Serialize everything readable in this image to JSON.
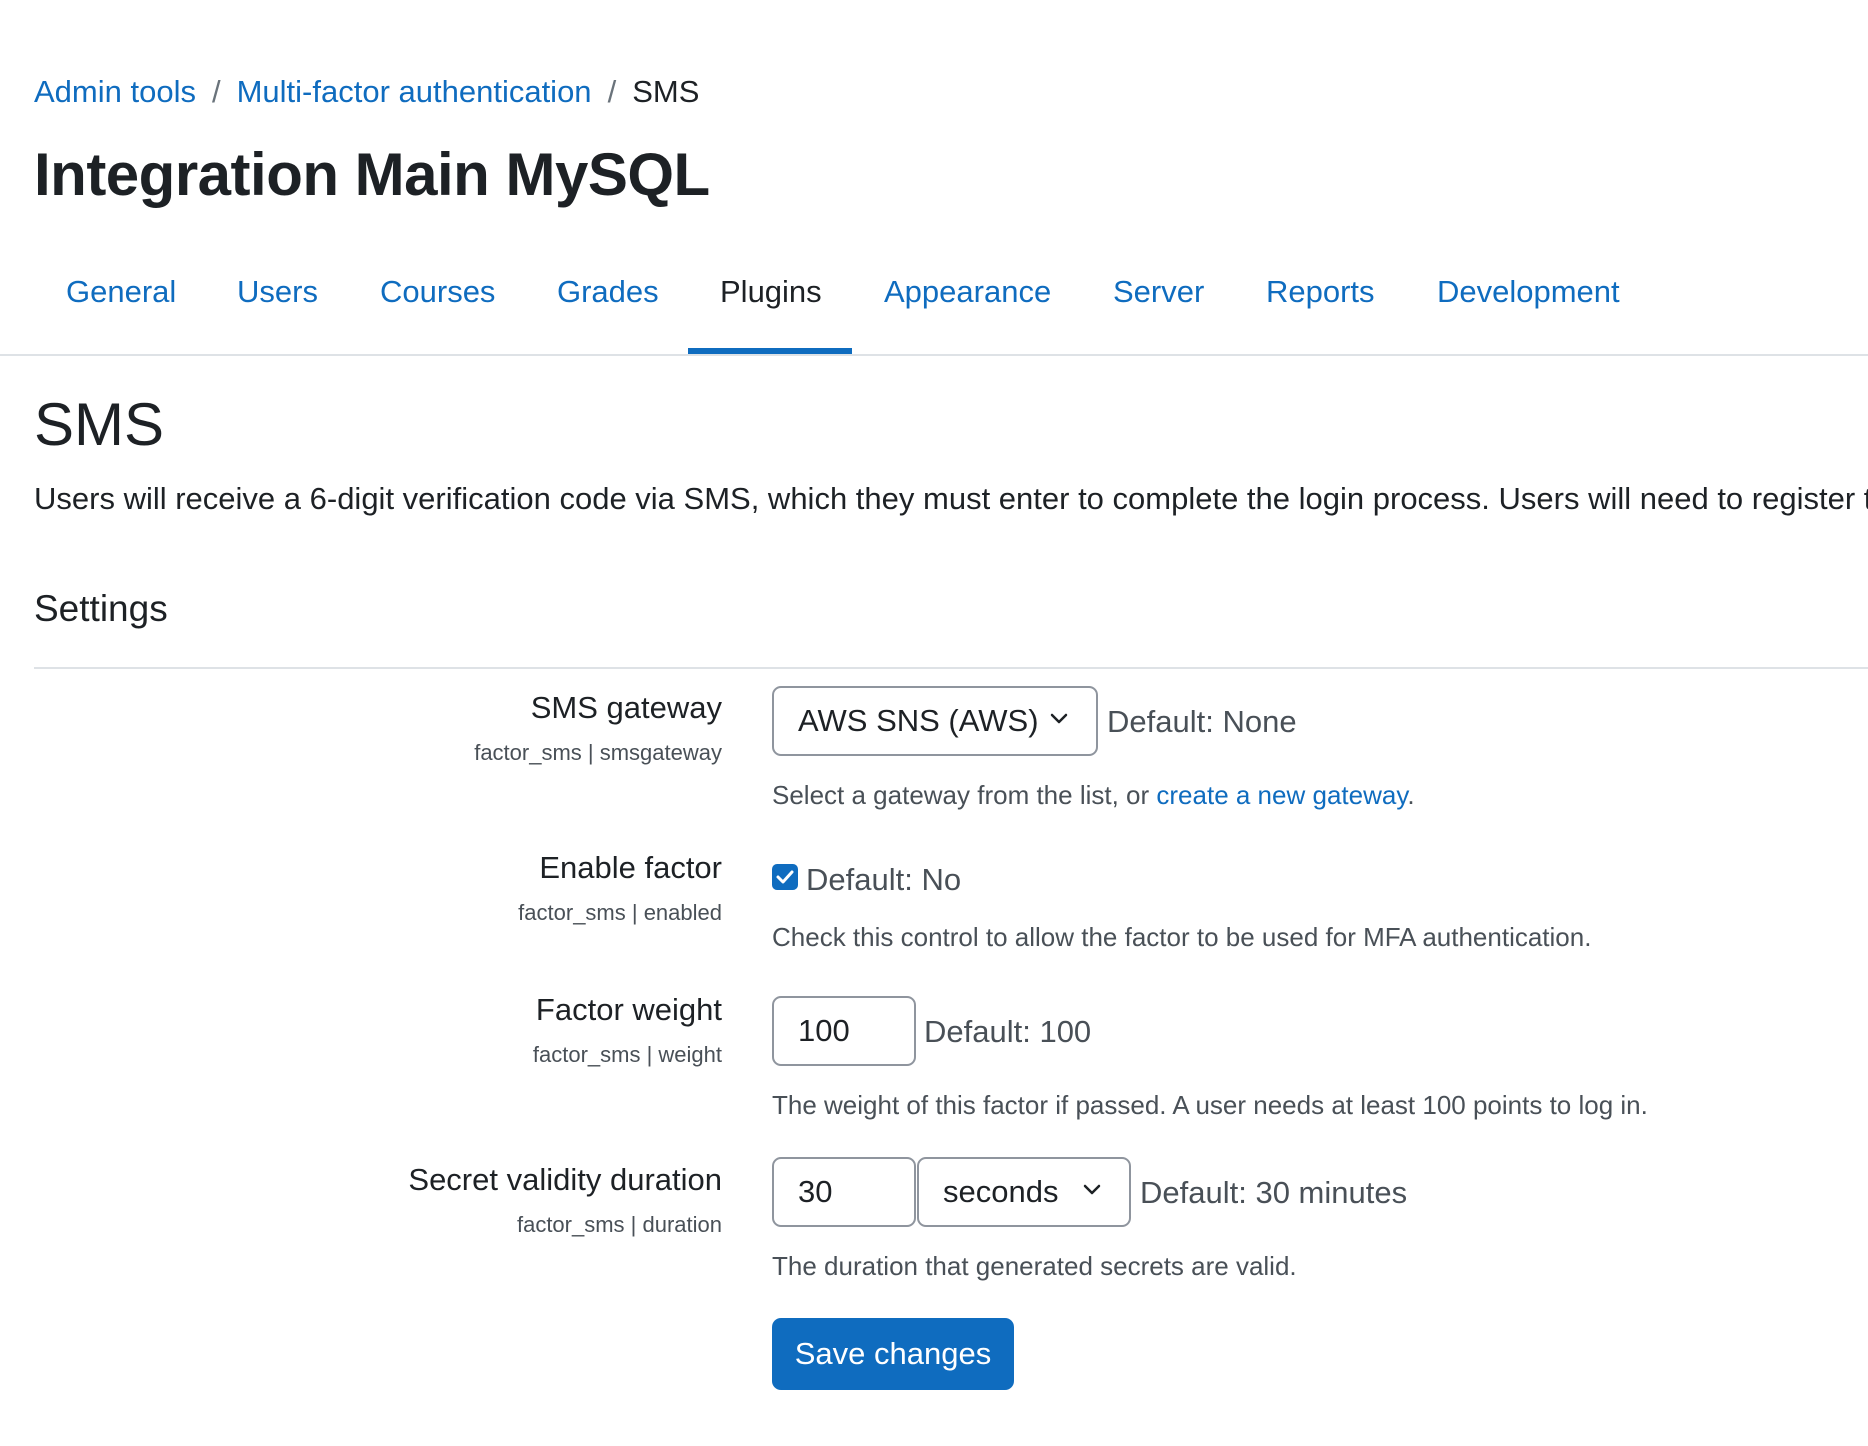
{
  "breadcrumb": {
    "items": [
      "Admin tools",
      "Multi-factor authentication"
    ],
    "current": "SMS",
    "separator": "/"
  },
  "site_title": "Integration Main MySQL",
  "tabs": [
    {
      "label": "General",
      "active": false
    },
    {
      "label": "Users",
      "active": false
    },
    {
      "label": "Courses",
      "active": false
    },
    {
      "label": "Grades",
      "active": false
    },
    {
      "label": "Plugins",
      "active": true
    },
    {
      "label": "Appearance",
      "active": false
    },
    {
      "label": "Server",
      "active": false
    },
    {
      "label": "Reports",
      "active": false
    },
    {
      "label": "Development",
      "active": false
    }
  ],
  "page": {
    "heading": "SMS",
    "description": "Users will receive a 6-digit verification code via SMS, which they must enter to complete the login process. Users will need to register t"
  },
  "settings": {
    "heading": "Settings",
    "sms_gateway": {
      "label": "SMS gateway",
      "sublabel": "factor_sms | smsgateway",
      "selected": "AWS SNS (AWS)",
      "default": "Default: None",
      "help_prefix": "Select a gateway from the list, or ",
      "help_link": "create a new gateway",
      "help_suffix": "."
    },
    "enable_factor": {
      "label": "Enable factor",
      "sublabel": "factor_sms | enabled",
      "checked": true,
      "default": "Default: No",
      "help": "Check this control to allow the factor to be used for MFA authentication."
    },
    "factor_weight": {
      "label": "Factor weight",
      "sublabel": "factor_sms | weight",
      "value": "100",
      "default": "Default: 100",
      "help": "The weight of this factor if passed. A user needs at least 100 points to log in."
    },
    "duration": {
      "label": "Secret validity duration",
      "sublabel": "factor_sms | duration",
      "value": "30",
      "unit": "seconds",
      "default": "Default: 30 minutes",
      "help": "The duration that generated secrets are valid."
    },
    "save_label": "Save changes"
  },
  "colors": {
    "link": "#0f6cbf",
    "primary_button": "#0f6cbf",
    "text": "#1d2125",
    "muted": "#495057"
  },
  "icons": {
    "select_chevron": "chevron-down-icon",
    "checkbox_check": "check-icon"
  }
}
